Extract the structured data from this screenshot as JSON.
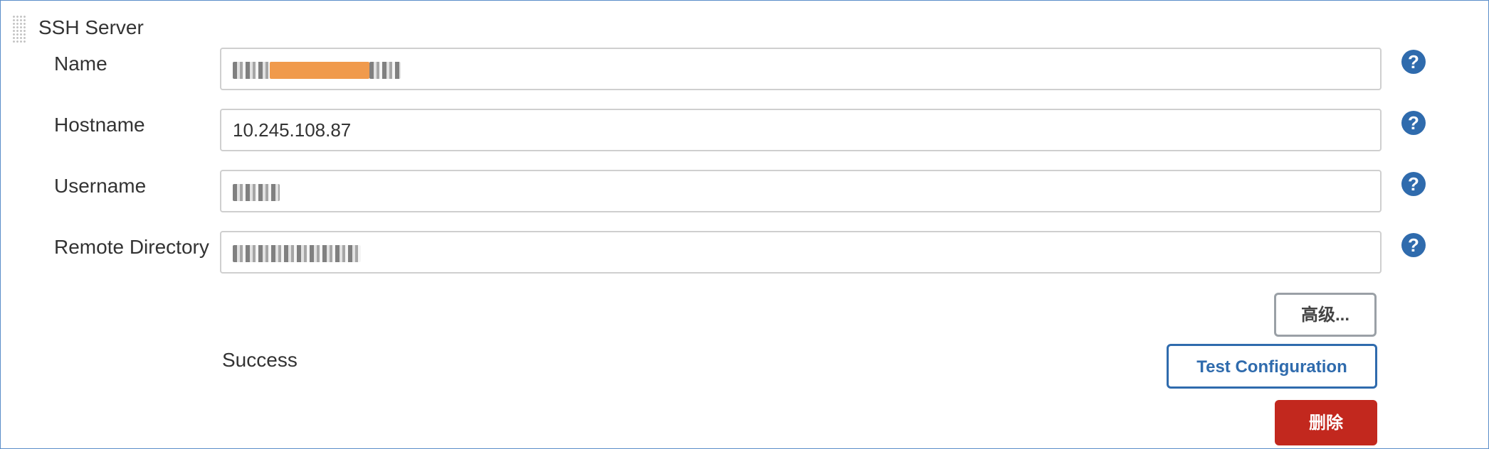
{
  "section": {
    "title": "SSH Server"
  },
  "fields": {
    "name": {
      "label": "Name"
    },
    "hostname": {
      "label": "Hostname",
      "value": "10.245.108.87"
    },
    "username": {
      "label": "Username"
    },
    "remote_directory": {
      "label": "Remote Directory"
    }
  },
  "buttons": {
    "advanced": "高级...",
    "test_configuration": "Test Configuration",
    "delete": "删除"
  },
  "status": {
    "text": "Success"
  },
  "help_icon_glyph": "?",
  "colors": {
    "accent": "#2f6bad",
    "danger": "#c2281e",
    "highlight": "#f09a4c",
    "frame_border": "#5b8ec9"
  },
  "icons": {
    "help": "help-icon",
    "drag": "drag-handle-icon"
  }
}
